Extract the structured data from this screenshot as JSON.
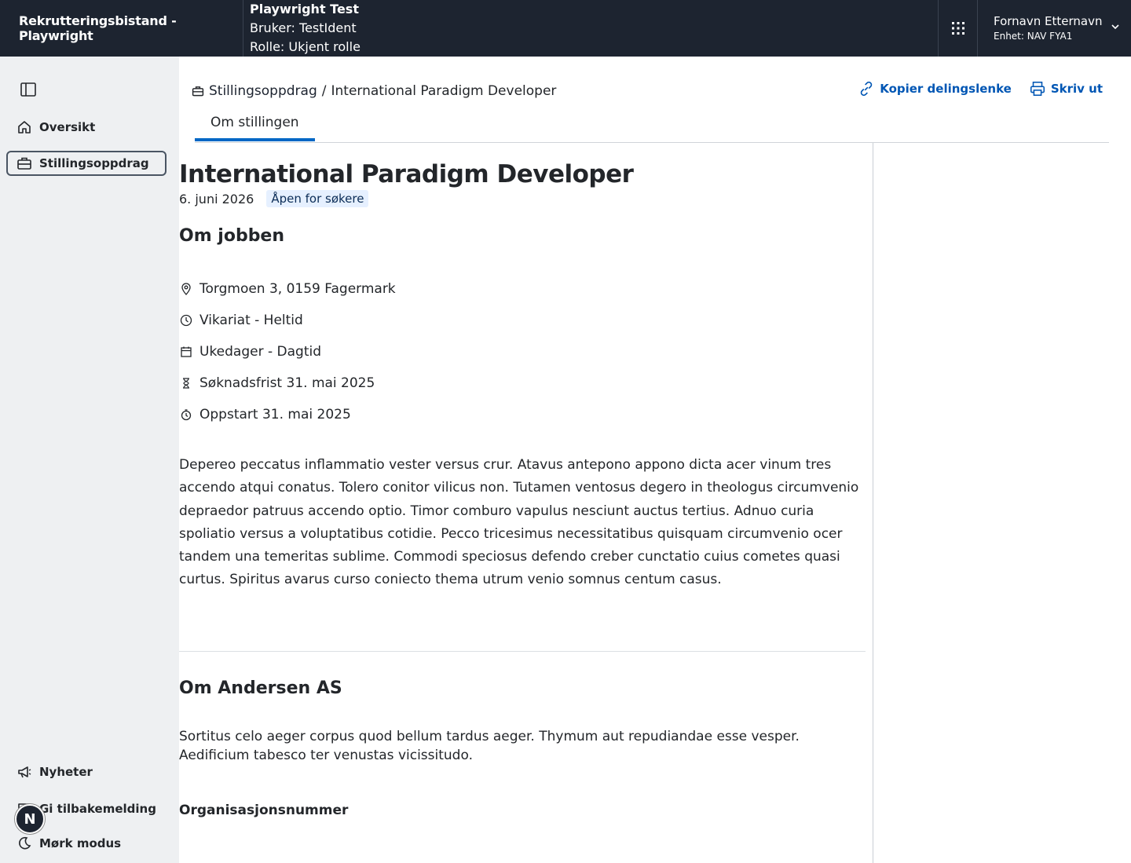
{
  "header": {
    "app_title": "Rekrutteringsbistand - Playwright",
    "test_title": "Playwright Test",
    "user_line": "Bruker: TestIdent",
    "role_line": "Rolle: Ukjent rolle",
    "user_name": "Fornavn Etternavn",
    "user_unit": "Enhet: NAV FYA1"
  },
  "sidebar": {
    "items": [
      {
        "label": "Oversikt",
        "icon": "home-icon"
      },
      {
        "label": "Stillingsoppdrag",
        "icon": "briefcase-icon",
        "active": true
      }
    ],
    "bottom": [
      {
        "label": "Nyheter",
        "icon": "megaphone-icon"
      },
      {
        "label": "Gi tilbakemelding",
        "icon": "chat-icon"
      },
      {
        "label": "Mørk modus",
        "icon": "moon-icon"
      }
    ],
    "avatar_letter": "N"
  },
  "breadcrumb": {
    "parent": "Stillingsoppdrag",
    "separator": "/",
    "current": "International Paradigm Developer"
  },
  "actions": {
    "copy_link": "Kopier delingslenke",
    "print": "Skriv ut"
  },
  "tabs": [
    {
      "label": "Om stillingen",
      "active": true
    }
  ],
  "job": {
    "title": "International Paradigm Developer",
    "date": "6. juni 2026",
    "status": "Åpen for søkere",
    "about_heading": "Om jobben",
    "facts": [
      {
        "icon": "location-pin-icon",
        "text": "Torgmoen 3, 0159 Fagermark"
      },
      {
        "icon": "clock-icon",
        "text": "Vikariat - Heltid"
      },
      {
        "icon": "calendar-icon",
        "text": "Ukedager - Dagtid"
      },
      {
        "icon": "hourglass-icon",
        "text": "Søknadsfrist 31. mai 2025"
      },
      {
        "icon": "stopwatch-icon",
        "text": "Oppstart 31. mai 2025"
      }
    ],
    "description": "Depereo peccatus inflammatio vester versus crur. Atavus antepono appono dicta acer vinum tres accendo atqui conatus. Tolero conitor vilicus non. Tutamen ventosus degero in theologus circumvenio depraedor patruus accendo optio. Timor comburo vapulus nesciunt auctus tertius. Adnuo curia spoliatio versus a voluptatibus cotidie. Pecco tricesimus necessitatibus quisquam circumvenio ocer tandem una temeritas sublime. Commodi speciosus defendo creber cunctatio cuius cometes quasi curtus. Spiritus avarus curso coniecto thema utrum venio somnus centum casus."
  },
  "employer": {
    "heading": "Om Andersen AS",
    "description": "Sortitus celo aeger corpus quod bellum tardus aeger. Thymum aut repudiandae esse vesper. Aedificium tabesco ter venustas vicissitudo.",
    "org_heading": "Organisasjonsnummer"
  },
  "colors": {
    "header_bg": "#1d2430",
    "sidebar_bg": "#eef0f2",
    "link": "#0056b4",
    "tab_underline": "#0067c5",
    "badge_bg": "#e6f0ff"
  }
}
